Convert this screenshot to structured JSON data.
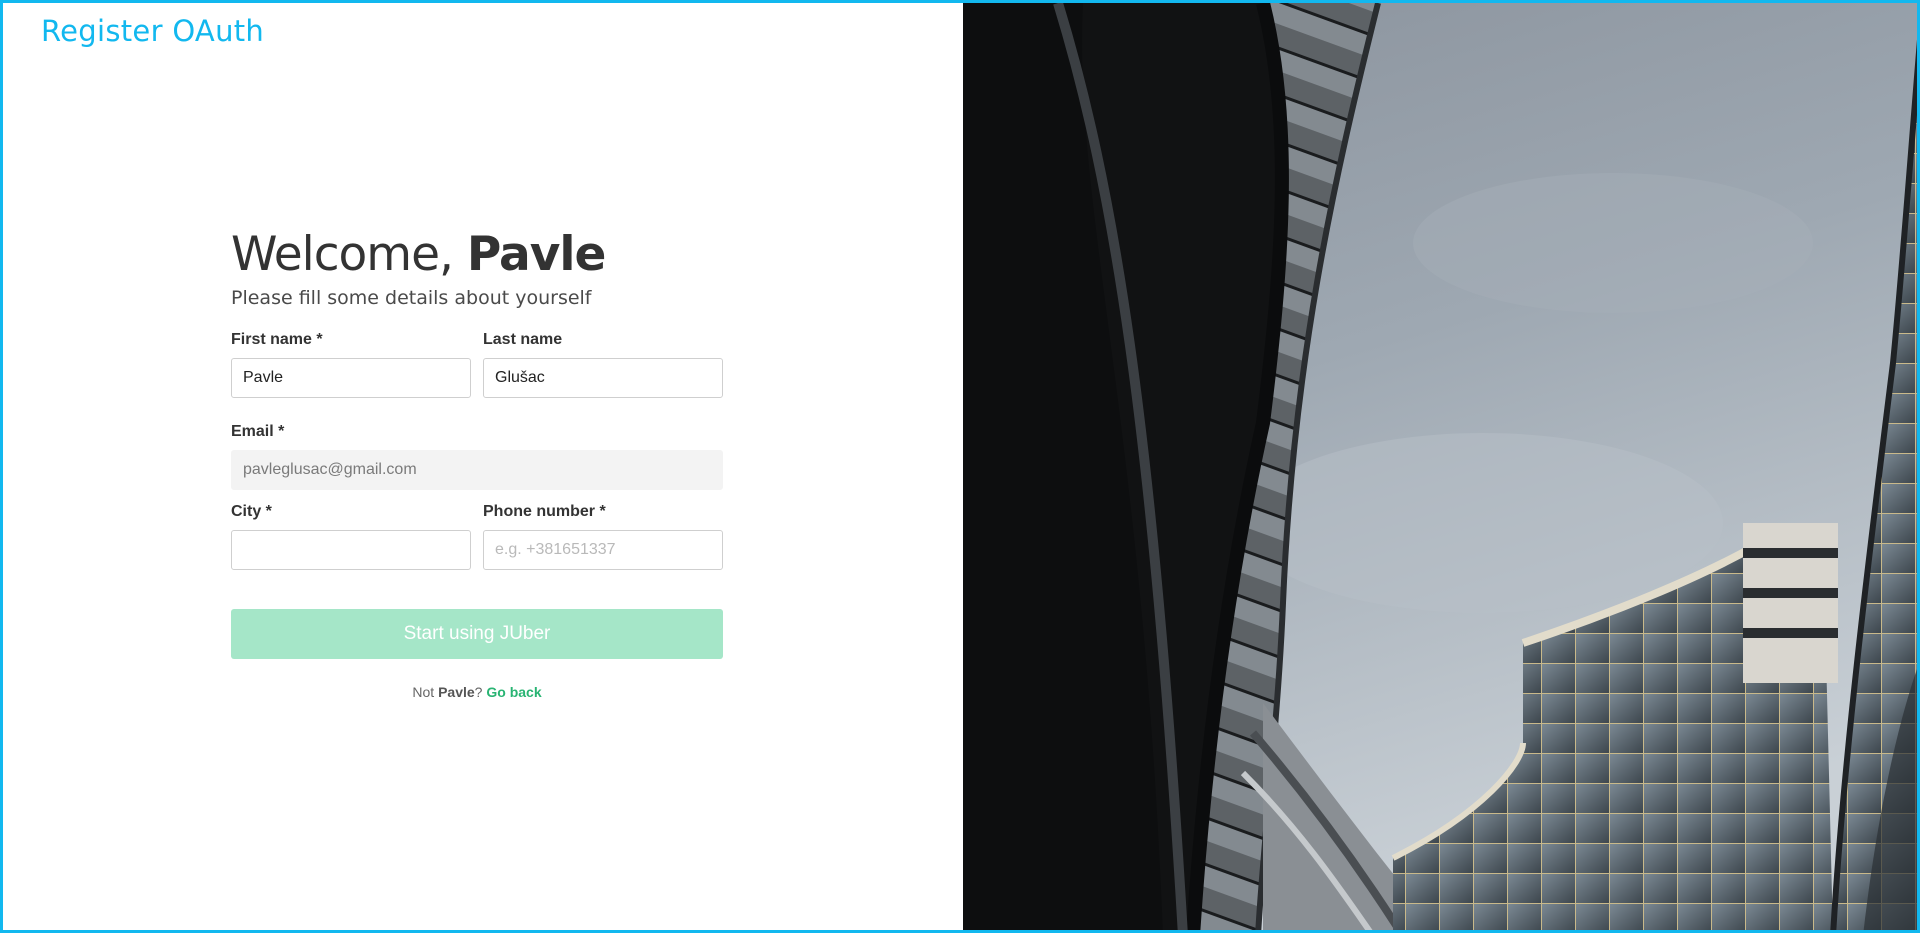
{
  "app": {
    "title": "Register OAuth"
  },
  "welcome": {
    "prefix": "Welcome, ",
    "name": "Pavle",
    "subtitle": "Please fill some details about yourself"
  },
  "form": {
    "first_name": {
      "label": "First name *",
      "value": "Pavle"
    },
    "last_name": {
      "label": "Last name",
      "value": "Glušac"
    },
    "email": {
      "label": "Email *",
      "value": "pavleglusac@gmail.com"
    },
    "city": {
      "label": "City *",
      "value": ""
    },
    "phone": {
      "label": "Phone number *",
      "value": "",
      "placeholder": "e.g. +381651337"
    },
    "submit_label": "Start using JUber"
  },
  "footer": {
    "not_text": "Not ",
    "name": "Pavle",
    "question": "? ",
    "go_back": "Go back"
  },
  "colors": {
    "accent": "#12b8ef",
    "submit_disabled": "#a5e6c8",
    "link": "#29b473"
  }
}
